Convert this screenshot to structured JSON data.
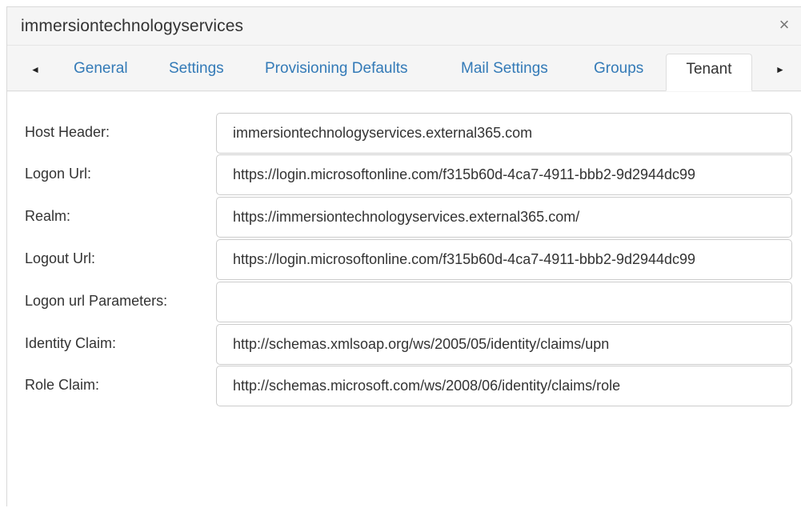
{
  "dialog": {
    "title": "immersiontechnologyservices",
    "close_glyph": "×"
  },
  "tabs": {
    "prev_glyph": "◄",
    "next_glyph": "►",
    "items": [
      {
        "label": "General",
        "active": false
      },
      {
        "label": "Settings",
        "active": false
      },
      {
        "label": "Provisioning Defaults",
        "active": false
      },
      {
        "label": "Mail Settings",
        "active": false
      },
      {
        "label": "Groups",
        "active": false
      },
      {
        "label": "Tenant",
        "active": true
      }
    ]
  },
  "form": {
    "fields": [
      {
        "label": "Host Header:",
        "value": "immersiontechnologyservices.external365.com"
      },
      {
        "label": "Logon Url:",
        "value": "https://login.microsoftonline.com/f315b60d-4ca7-4911-bbb2-9d2944dc99"
      },
      {
        "label": "Realm:",
        "value": "https://immersiontechnologyservices.external365.com/"
      },
      {
        "label": "Logout Url:",
        "value": "https://login.microsoftonline.com/f315b60d-4ca7-4911-bbb2-9d2944dc99"
      },
      {
        "label": "Logon url Parameters:",
        "value": ""
      },
      {
        "label": "Identity Claim:",
        "value": "http://schemas.xmlsoap.org/ws/2005/05/identity/claims/upn"
      },
      {
        "label": "Role Claim:",
        "value": "http://schemas.microsoft.com/ws/2008/06/identity/claims/role"
      }
    ]
  },
  "colors": {
    "tab_link": "#337ab7",
    "text": "#333333",
    "header_bg": "#f5f5f5",
    "border": "#cccccc"
  }
}
